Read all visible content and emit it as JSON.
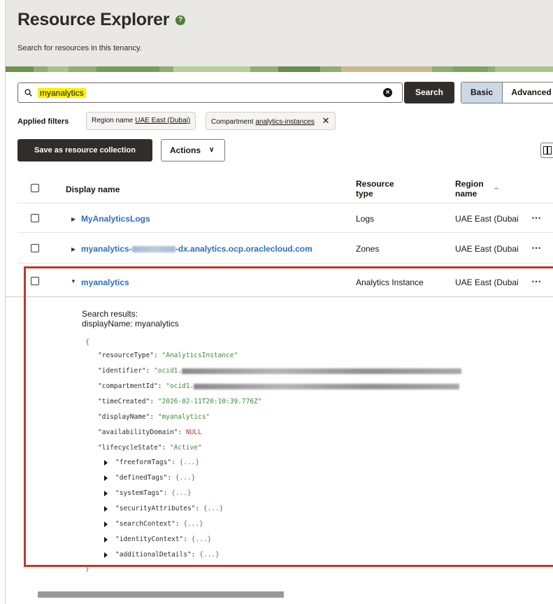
{
  "header": {
    "title": "Resource Explorer",
    "help_icon": "help-circle-icon",
    "subtitle": "Search for resources in this tenancy."
  },
  "search": {
    "value": "myanalytics",
    "search_label": "Search",
    "mode_basic": "Basic",
    "mode_advanced": "Advanced",
    "icons": [
      "search-icon",
      "clear-icon"
    ]
  },
  "filters": {
    "label": "Applied filters",
    "chips": [
      {
        "key": "Region name",
        "value": "UAE East (Dubai)"
      },
      {
        "key": "Compartment",
        "value": "analytics-instances",
        "removable": true
      }
    ]
  },
  "toolbar": {
    "save_collection_label": "Save as resource collection",
    "actions_label": "Actions",
    "columns_icon": "columns-icon"
  },
  "table": {
    "headers": {
      "display_name": "Display name",
      "resource_type_1": "Resource",
      "resource_type_2": "type",
      "region_1": "Region",
      "region_2": "name"
    },
    "rows": [
      {
        "name": "MyAnalyticsLogs",
        "type": "Logs",
        "region": "UAE East (Dubai",
        "expanded": false
      },
      {
        "name_prefix": "myanalytics-",
        "name_suffix": "-dx.analytics.ocp.oraclecloud.com",
        "type": "Zones",
        "region": "UAE East (Dubai",
        "expanded": false
      },
      {
        "name": "myanalytics",
        "type": "Analytics Instance",
        "region": "UAE East (Dubai",
        "expanded": true
      }
    ],
    "kebab": "⋯"
  },
  "details": {
    "results_title": "Search results:",
    "results_name": "displayName: myanalytics",
    "open_brace": "{",
    "close_brace": "}",
    "fields": [
      {
        "key": "\"resourceType\": ",
        "value": "\"AnalyticsInstance\""
      },
      {
        "key": "\"identifier\": ",
        "value": "\"ocid1."
      },
      {
        "key": "\"compartmentId\": ",
        "value": "\"ocid1."
      },
      {
        "key": "\"timeCreated\": ",
        "value": "\"2026-02-11T20:10:39.776Z\""
      },
      {
        "key": "\"displayName\": ",
        "value": "\"myanalytics\""
      },
      {
        "key": "\"availabilityDomain\": ",
        "value": "NULL"
      },
      {
        "key": "\"lifecycleState\": ",
        "value": "\"Active\""
      }
    ],
    "collapsed": [
      {
        "key": "\"freeformTags\": ",
        "value": "{...}"
      },
      {
        "key": "\"definedTags\": ",
        "value": "{...}"
      },
      {
        "key": "\"systemTags\": ",
        "value": "{...}"
      },
      {
        "key": "\"securityAttributes\": ",
        "value": "{...}"
      },
      {
        "key": "\"searchContext\": ",
        "value": "{...}"
      },
      {
        "key": "\"identityContext\": ",
        "value": "{...}"
      },
      {
        "key": "\"additionalDetails\": ",
        "value": "{...}"
      }
    ]
  },
  "colors": {
    "accent": "#2a6fbf",
    "primary_button": "#312d2a",
    "highlight": "#fbf000",
    "selected_segment": "#cbd8e6",
    "expanded_border": "#c0392b"
  }
}
